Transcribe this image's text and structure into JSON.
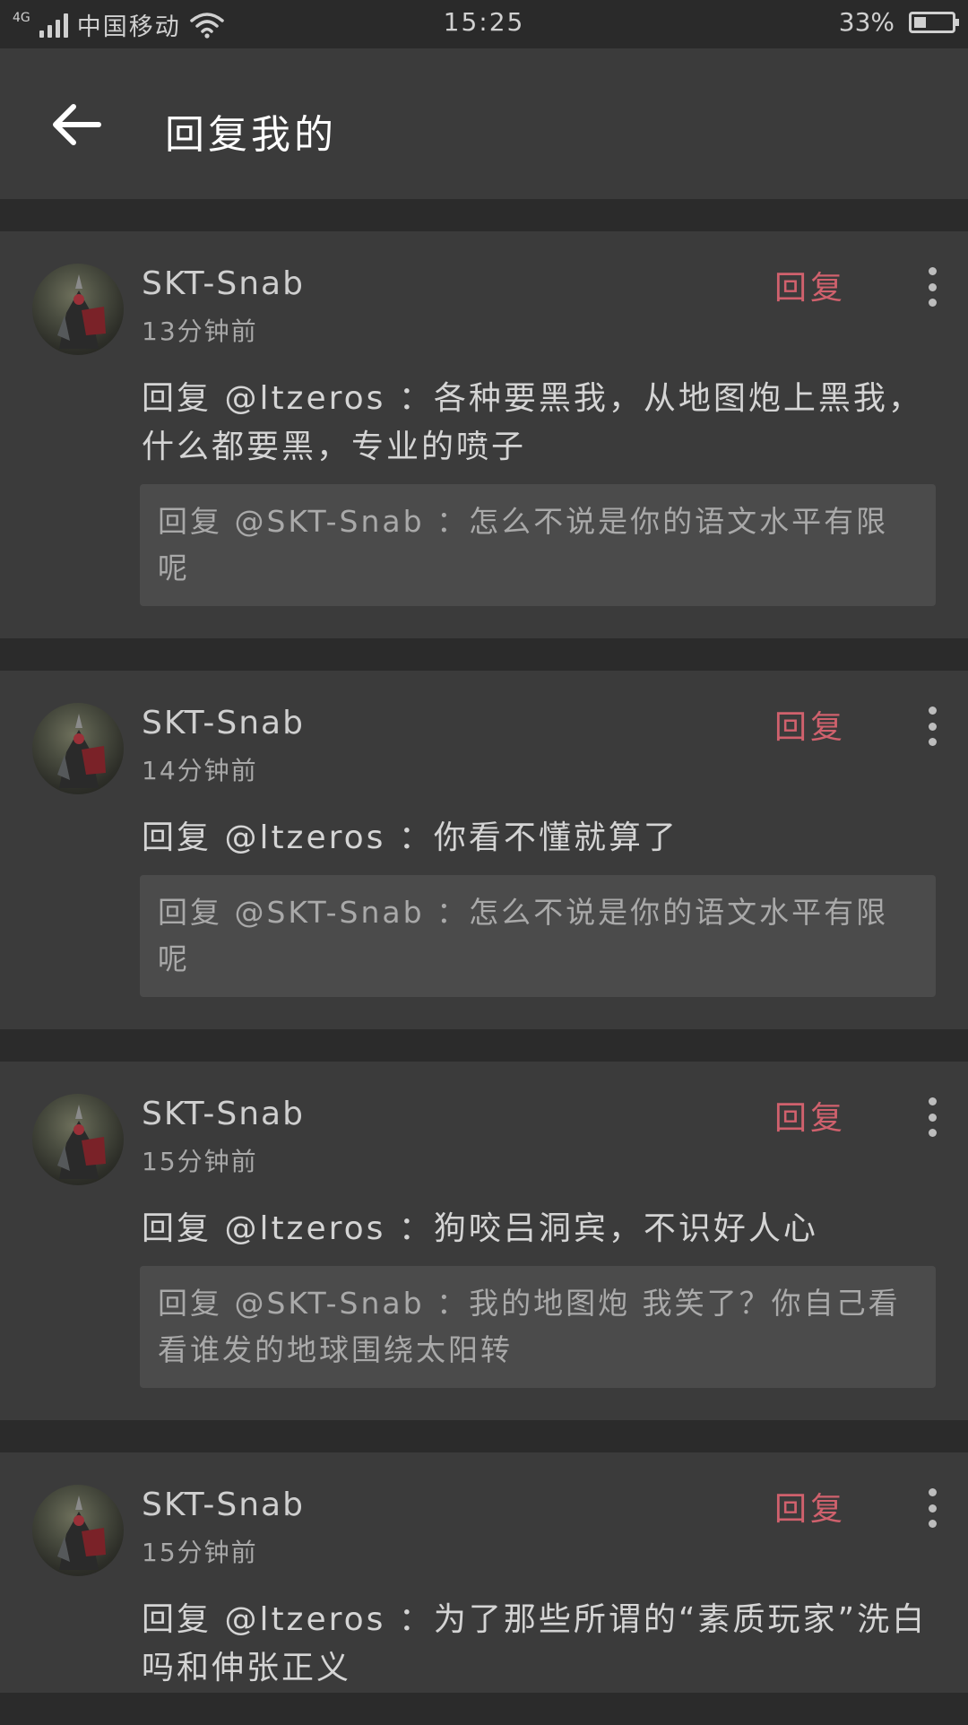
{
  "status_bar": {
    "network_type": "4G",
    "carrier": "中国移动",
    "time": "15:25",
    "battery_percent_text": "33%",
    "battery_level": 0.33
  },
  "header": {
    "title": "回复我的"
  },
  "items": [
    {
      "username": "SKT-Snab",
      "time": "13分钟前",
      "reply_label": "回复",
      "comment": "回复 @ltzeros ：各种要黑我，从地图炮上黑我，什么都要黑，专业的喷子",
      "quote": "回复 @SKT-Snab ：怎么不说是你的语文水平有限呢"
    },
    {
      "username": "SKT-Snab",
      "time": "14分钟前",
      "reply_label": "回复",
      "comment": "回复 @ltzeros ：你看不懂就算了",
      "quote": "回复 @SKT-Snab ：怎么不说是你的语文水平有限呢"
    },
    {
      "username": "SKT-Snab",
      "time": "15分钟前",
      "reply_label": "回复",
      "comment": "回复 @ltzeros ：狗咬吕洞宾，不识好人心",
      "quote": "回复 @SKT-Snab ：我的地图炮 我笑了？你自己看看谁发的地球围绕太阳转"
    },
    {
      "username": "SKT-Snab",
      "time": "15分钟前",
      "reply_label": "回复",
      "comment": "回复 @ltzeros ：为了那些所谓的“素质玩家”洗白吗和伸张正义",
      "quote": ""
    }
  ],
  "colors": {
    "reply_accent": "#d0616d",
    "card_background": "#3b3b3b",
    "quote_background": "#4b4b4b",
    "page_background": "#2b2b2b"
  },
  "icons": {
    "back": "arrow-left-icon",
    "more": "more-vertical-icon",
    "wifi": "wifi-icon",
    "signal": "signal-icon",
    "battery": "battery-icon"
  }
}
